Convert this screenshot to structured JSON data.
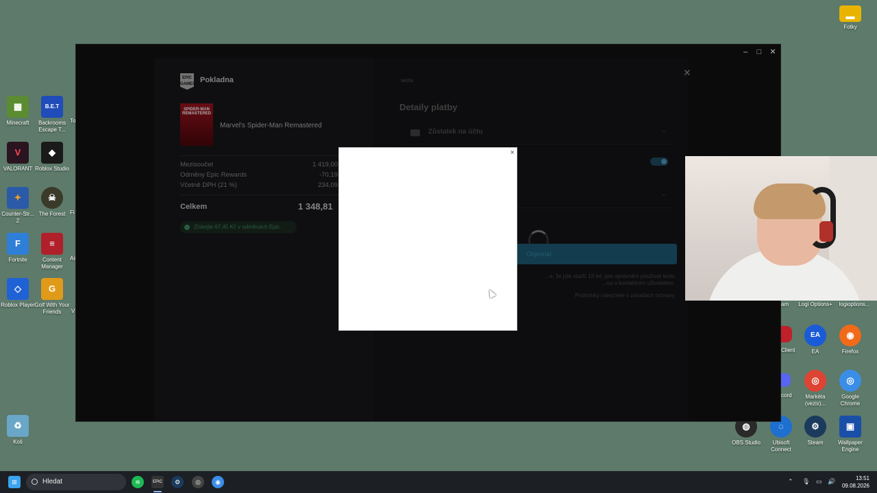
{
  "desktop": {
    "left_icons": [
      {
        "label": "Minecraft",
        "color": "#5b8c32"
      },
      {
        "label": "Backrooms Escape T...",
        "glyph": "B.E.T",
        "color": "#1f4cb8"
      },
      {
        "label": "VALORANT",
        "glyph": "V",
        "color": "#2a1420"
      },
      {
        "label": "Roblox Studio",
        "color": "#1a1a1a"
      },
      {
        "label": "Counter-Str... 2",
        "color": "#2b5aa8"
      },
      {
        "label": "The Forest",
        "color": "#3a3a2a"
      },
      {
        "label": "Fortnite",
        "glyph": "F",
        "color": "#2f7fd8"
      },
      {
        "label": "Content Manager",
        "color": "#b0202a"
      },
      {
        "label": "Roblox Player",
        "color": "#1f62d6"
      },
      {
        "label": "Golf With Your Friends",
        "glyph": "G",
        "color": "#e09a1a"
      },
      {
        "label": "Koš",
        "color": "#6aa6c8"
      }
    ],
    "clipped_left": [
      "To R",
      "Fi",
      "As C",
      "V"
    ],
    "right_icons": [
      {
        "label": "Fotky",
        "color": "#e8b400"
      },
      {
        "label": "Logi Options+",
        "color": "#333"
      },
      {
        "label": "logioptions...",
        "color": "#444"
      },
      {
        "label": "EA",
        "glyph": "EA",
        "color": "#1a5bd8"
      },
      {
        "label": "Firefox",
        "color": "#f06a1a"
      },
      {
        "label": "Markéta (vezix)...",
        "color": "#dd4433"
      },
      {
        "label": "Google Chrome",
        "color": "#3b8ee8"
      },
      {
        "label": "OBS Studio",
        "color": "#2a2a2a"
      },
      {
        "label": "Ubisoft Connect",
        "color": "#1d6fd0"
      },
      {
        "label": "Steam",
        "color": "#1b3a5c"
      },
      {
        "label": "Wallpaper Engine",
        "color": "#1a4fa8"
      }
    ],
    "clipped_right": [
      "am",
      "Client",
      "cord"
    ]
  },
  "epic": {
    "header_title": "Pokladna",
    "logo_text": "EPIC GAMES",
    "game_title": "Marvel's Spider-Man Remastered",
    "cover_text": "SPIDER-MAN REMASTERED",
    "summary": [
      {
        "label": "Mezisoučet",
        "value": "1 419,00"
      },
      {
        "label": "Odměny Epic Rewards",
        "value": "-70,19"
      },
      {
        "label": "Včetně DPH (21 %)",
        "value": "234,09"
      }
    ],
    "total_label": "Celkem",
    "total_value": "1 348,81",
    "earn_text": "Získejte 67,45 Kč v odměnách Epic.",
    "payment": {
      "user": "vezix",
      "title": "Detaily platby",
      "option1": "Zůstatek na účtu",
      "order_button": "Objednat",
      "legal1": "...e, že jste starší 18 let, jste oprávnění používat tento",
      "legal2": "...ou s kontaktním uživatelem.",
      "legal3": "Podmínky naleznete v zásadách ochrany"
    }
  },
  "modal": {
    "close": "×"
  },
  "taskbar": {
    "search_placeholder": "Hledat",
    "time": "13:51",
    "date": "09.08.2026"
  }
}
